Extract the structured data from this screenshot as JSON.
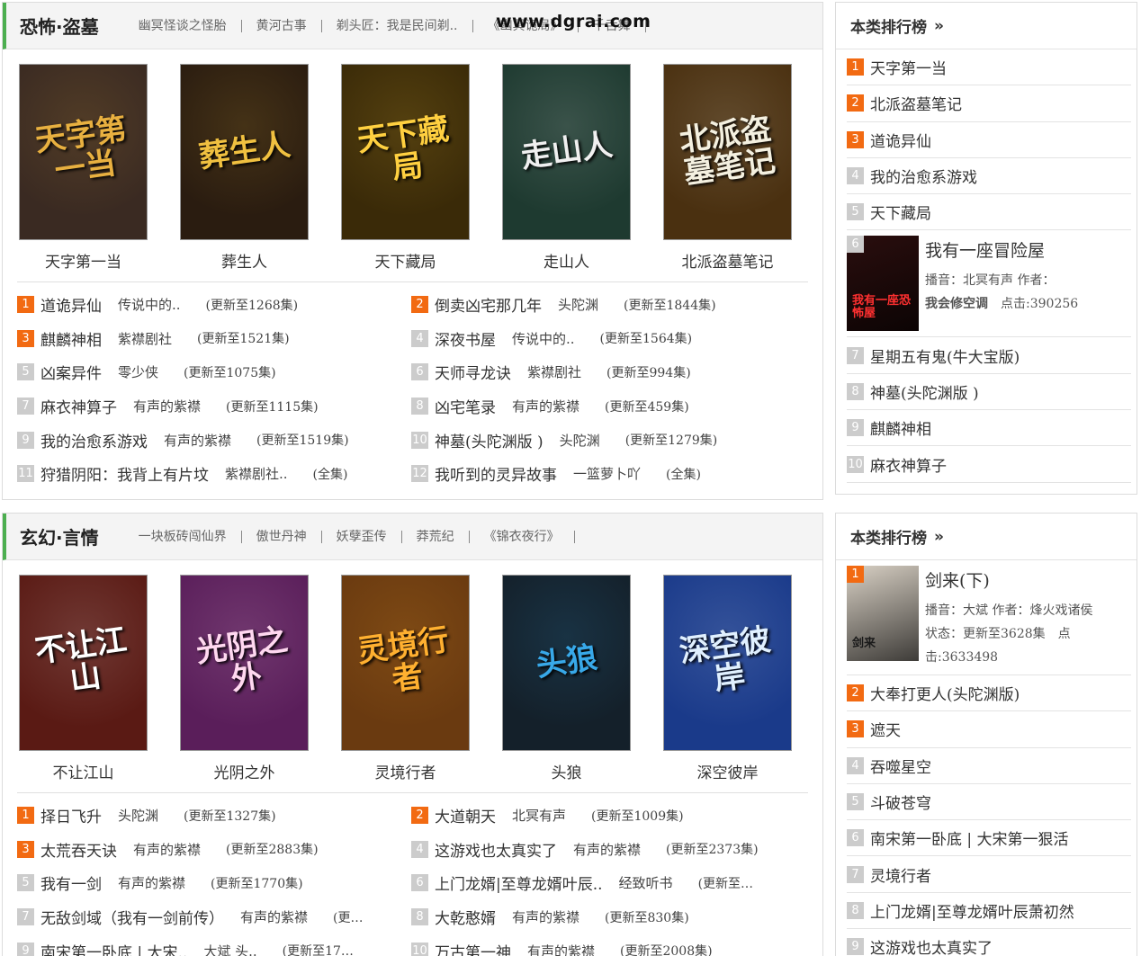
{
  "watermark": "www.dgrai.com",
  "sections": [
    {
      "title": "恐怖·盗墓",
      "sublinks": [
        "幽冥怪谈之怪胎",
        "黄河古事",
        "剃头匠：我是民间剃..",
        "《幽冥诡局》",
        "千舌舞"
      ],
      "covers": [
        {
          "title": "天字第一当",
          "art": "天字第一当",
          "bg": "#3a2a22",
          "fg": "#e8b040"
        },
        {
          "title": "葬生人",
          "art": "葬生人",
          "bg": "#2a1c10",
          "fg": "#f0c040"
        },
        {
          "title": "天下藏局",
          "art": "天下藏局",
          "bg": "#3a2a08",
          "fg": "#ffd040"
        },
        {
          "title": "走山人",
          "art": "走山人",
          "bg": "#1e3a30",
          "fg": "#f0f0f0"
        },
        {
          "title": "北派盗墓笔记",
          "art": "北派盗墓笔记",
          "bg": "#4a3010",
          "fg": "#f4f0e0"
        }
      ],
      "items": [
        {
          "num": "1",
          "title": "道诡异仙",
          "author": "传说中的..",
          "status": "(更新至1268集)"
        },
        {
          "num": "2",
          "title": "倒卖凶宅那几年",
          "author": "头陀渊",
          "status": "(更新至1844集)"
        },
        {
          "num": "3",
          "title": "麒麟神相",
          "author": "紫襟剧社",
          "status": "(更新至1521集)"
        },
        {
          "num": "4",
          "title": "深夜书屋",
          "author": "传说中的..",
          "status": "(更新至1564集)"
        },
        {
          "num": "5",
          "title": "凶案异件",
          "author": "零少侠",
          "status": "(更新至1075集)"
        },
        {
          "num": "6",
          "title": "天师寻龙诀",
          "author": "紫襟剧社",
          "status": "(更新至994集)"
        },
        {
          "num": "7",
          "title": "麻衣神算子",
          "author": "有声的紫襟",
          "status": "(更新至1115集)"
        },
        {
          "num": "8",
          "title": "凶宅笔录",
          "author": "有声的紫襟",
          "status": "(更新至459集)"
        },
        {
          "num": "9",
          "title": "我的治愈系游戏",
          "author": "有声的紫襟",
          "status": "(更新至1519集)"
        },
        {
          "num": "10",
          "title": "神墓(头陀渊版 )",
          "author": "头陀渊",
          "status": "(更新至1279集)"
        },
        {
          "num": "11",
          "title": "狩猎阴阳：我背上有片坟",
          "author": "紫襟剧社..",
          "status": "(全集)"
        },
        {
          "num": "12",
          "title": "我听到的灵异故事",
          "author": "一篮萝卜吖",
          "status": "(全集)"
        }
      ]
    },
    {
      "title": "玄幻·言情",
      "sublinks": [
        "一块板砖闯仙界",
        "傲世丹神",
        "妖孽歪传",
        "莽荒纪",
        "《锦衣夜行》"
      ],
      "covers": [
        {
          "title": "不让江山",
          "art": "不让江山",
          "bg": "#5a1a14",
          "fg": "#ffffff"
        },
        {
          "title": "光阴之外",
          "art": "光阴之外",
          "bg": "#5a1e5a",
          "fg": "#ffd8f0"
        },
        {
          "title": "灵境行者",
          "art": "灵境行者",
          "bg": "#6a3a10",
          "fg": "#ffb030"
        },
        {
          "title": "头狼",
          "art": "头狼",
          "bg": "#14202a",
          "fg": "#38a8e8"
        },
        {
          "title": "深空彼岸",
          "art": "深空彼岸",
          "bg": "#1a3a8a",
          "fg": "#e0f0ff"
        }
      ],
      "items": [
        {
          "num": "1",
          "title": "择日飞升",
          "author": "头陀渊",
          "status": "(更新至1327集)"
        },
        {
          "num": "2",
          "title": "大道朝天",
          "author": "北冥有声",
          "status": "(更新至1009集)"
        },
        {
          "num": "3",
          "title": "太荒吞天诀",
          "author": "有声的紫襟",
          "status": "(更新至2883集)"
        },
        {
          "num": "4",
          "title": "这游戏也太真实了",
          "author": "有声的紫襟",
          "status": "(更新至2373集)"
        },
        {
          "num": "5",
          "title": "我有一剑",
          "author": "有声的紫襟",
          "status": "(更新至1770集)"
        },
        {
          "num": "6",
          "title": "上门龙婿|至尊龙婿叶辰..",
          "author": "经致听书",
          "status": "(更新至…"
        },
        {
          "num": "7",
          "title": "无敌剑域（我有一剑前传）",
          "author": "有声的紫襟",
          "status": "(更…"
        },
        {
          "num": "8",
          "title": "大乾憨婿",
          "author": "有声的紫襟",
          "status": "(更新至830集)"
        },
        {
          "num": "9",
          "title": "南宋第一卧底 | 大宋..",
          "author": "大斌 头..",
          "status": "(更新至17…"
        },
        {
          "num": "10",
          "title": "万古第一神",
          "author": "有声的紫襟",
          "status": "(更新至2008集)"
        }
      ]
    }
  ],
  "rankings": [
    {
      "header": "本类排行榜",
      "arrow": "»",
      "items_before": [
        {
          "num": "1",
          "title": "天字第一当"
        },
        {
          "num": "2",
          "title": "北派盗墓笔记"
        },
        {
          "num": "3",
          "title": "道诡异仙"
        },
        {
          "num": "4",
          "title": "我的治愈系游戏"
        },
        {
          "num": "5",
          "title": "天下藏局"
        }
      ],
      "featured": {
        "num": "6",
        "title": "我有一座冒险屋",
        "narrator_line": "播音：北冥有声 作者：",
        "author_line": "我会修空调",
        "clicks": "点击:390256",
        "art": "我有一座恐怖屋",
        "bg": "#2a0e0e",
        "fg": "#ff3030"
      },
      "items_after": [
        {
          "num": "7",
          "title": "星期五有鬼(牛大宝版)"
        },
        {
          "num": "8",
          "title": "神墓(头陀渊版 )"
        },
        {
          "num": "9",
          "title": "麒麟神相"
        },
        {
          "num": "10",
          "title": "麻衣神算子"
        }
      ]
    },
    {
      "header": "本类排行榜",
      "arrow": "»",
      "featured": {
        "num": "1",
        "title": "剑来(下)",
        "narrator_line": "播音：大斌 作者：烽火戏诸侯",
        "status_line": "状态：更新至3628集　点",
        "clicks": "击:3633498",
        "art": "剑来",
        "bg": "#d8d0c4",
        "fg": "#1a1a1a"
      },
      "items_after": [
        {
          "num": "2",
          "title": "大奉打更人(头陀渊版)"
        },
        {
          "num": "3",
          "title": "遮天"
        },
        {
          "num": "4",
          "title": "吞噬星空"
        },
        {
          "num": "5",
          "title": "斗破苍穹"
        },
        {
          "num": "6",
          "title": "南宋第一卧底 | 大宋第一狠活"
        },
        {
          "num": "7",
          "title": "灵境行者"
        },
        {
          "num": "8",
          "title": "上门龙婿|至尊龙婿叶辰萧初然"
        },
        {
          "num": "9",
          "title": "这游戏也太真实了"
        }
      ]
    }
  ],
  "colors": {
    "accent_green": "#4caf50",
    "hot_rank": "#f26a12",
    "cold_rank": "#cccccc"
  }
}
